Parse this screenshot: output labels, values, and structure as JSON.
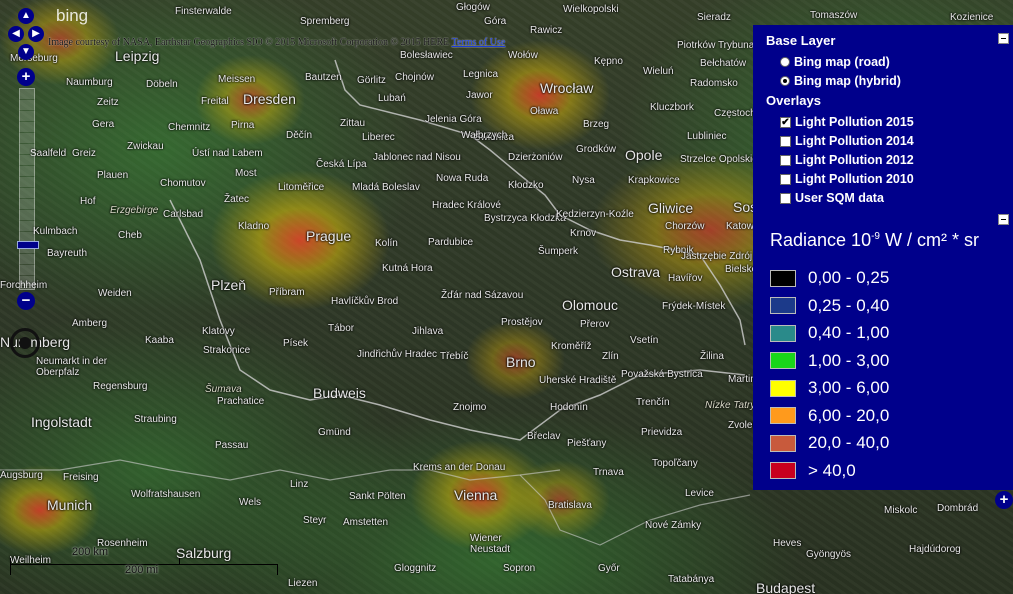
{
  "map": {
    "provider_logo": "bing",
    "credit_text": "Image courtesy of NASA, Earthstar Geographics SIO © 2015 Microsoft Corporation © 2015 HERE",
    "terms_link": "Terms of Use",
    "scale_labels": [
      "200 km",
      "200 mi"
    ],
    "places": [
      {
        "name": "Finsterwalde"
      },
      {
        "name": "Spremberg"
      },
      {
        "name": "Głogów"
      },
      {
        "name": "Góra"
      },
      {
        "name": "Rawicz"
      },
      {
        "name": "Wielkopolski"
      },
      {
        "name": "Sieradz"
      },
      {
        "name": "Tomaszów"
      },
      {
        "name": "Kozienice"
      },
      {
        "name": "Merseburg"
      },
      {
        "name": "Leipzig"
      },
      {
        "name": "Bolesławiec"
      },
      {
        "name": "Wołów"
      },
      {
        "name": "Kępno"
      },
      {
        "name": "Piotrków Trybunalski"
      },
      {
        "name": "Bełchatów"
      },
      {
        "name": "Naumburg"
      },
      {
        "name": "Meissen"
      },
      {
        "name": "Bautzen"
      },
      {
        "name": "Görlitz"
      },
      {
        "name": "Chojnów"
      },
      {
        "name": "Legnica"
      },
      {
        "name": "Wrocław"
      },
      {
        "name": "Wieluń"
      },
      {
        "name": "Radomsko"
      },
      {
        "name": "Zeitz"
      },
      {
        "name": "Döbeln"
      },
      {
        "name": "Freital"
      },
      {
        "name": "Dresden"
      },
      {
        "name": "Lubań"
      },
      {
        "name": "Jawor"
      },
      {
        "name": "Oława"
      },
      {
        "name": "Gera"
      },
      {
        "name": "Chemnitz"
      },
      {
        "name": "Pirna"
      },
      {
        "name": "Zittau"
      },
      {
        "name": "Jelenia Góra"
      },
      {
        "name": "Świdnica"
      },
      {
        "name": "Brzeg"
      },
      {
        "name": "Kluczbork"
      },
      {
        "name": "Częstochowa"
      },
      {
        "name": "Saalfeld"
      },
      {
        "name": "Greiz"
      },
      {
        "name": "Zwickau"
      },
      {
        "name": "Ústí nad Labem"
      },
      {
        "name": "Děčín"
      },
      {
        "name": "Liberec"
      },
      {
        "name": "Wałbrzych"
      },
      {
        "name": "Grodków"
      },
      {
        "name": "Opole"
      },
      {
        "name": "Lubliniec"
      },
      {
        "name": "Plauen"
      },
      {
        "name": "Chomutov"
      },
      {
        "name": "Most"
      },
      {
        "name": "Česká Lípa"
      },
      {
        "name": "Jablonec nad Nisou"
      },
      {
        "name": "Dzierżoniów"
      },
      {
        "name": "Strzelce Opolskie"
      },
      {
        "name": "Hof"
      },
      {
        "name": "Erzgebirge"
      },
      {
        "name": "Žatec"
      },
      {
        "name": "Litoměřice"
      },
      {
        "name": "Mladá Boleslav"
      },
      {
        "name": "Nowa Ruda"
      },
      {
        "name": "Kłodzko"
      },
      {
        "name": "Nysa"
      },
      {
        "name": "Krapkowice"
      },
      {
        "name": "Kulmbach"
      },
      {
        "name": "Cheb"
      },
      {
        "name": "Carlsbad"
      },
      {
        "name": "Kladno"
      },
      {
        "name": "Prague"
      },
      {
        "name": "Kolín"
      },
      {
        "name": "Hradec Králové"
      },
      {
        "name": "Bystrzyca Kłodzka"
      },
      {
        "name": "Kędzierzyn-Koźle"
      },
      {
        "name": "Gliwice"
      },
      {
        "name": "Sosnowiec"
      },
      {
        "name": "Bayreuth"
      },
      {
        "name": "Pardubice"
      },
      {
        "name": "Krnov"
      },
      {
        "name": "Rybnik"
      },
      {
        "name": "Chorzów"
      },
      {
        "name": "Katowice"
      },
      {
        "name": "Forchheim"
      },
      {
        "name": "Weiden"
      },
      {
        "name": "Plzeň"
      },
      {
        "name": "Příbram"
      },
      {
        "name": "Kutná Hora"
      },
      {
        "name": "Šumperk"
      },
      {
        "name": "Ostrava"
      },
      {
        "name": "Jastrzębie Zdrój"
      },
      {
        "name": "Bielsko"
      },
      {
        "name": "Havlíčkův Brod"
      },
      {
        "name": "Žďár nad Sázavou"
      },
      {
        "name": "Olomouc"
      },
      {
        "name": "Havířov"
      },
      {
        "name": "Frýdek-Místek"
      },
      {
        "name": "Amberg"
      },
      {
        "name": "Klatovy"
      },
      {
        "name": "Tábor"
      },
      {
        "name": "Jihlava"
      },
      {
        "name": "Prostějov"
      },
      {
        "name": "Přerov"
      },
      {
        "name": "Vsetín"
      },
      {
        "name": "Nuremberg"
      },
      {
        "name": "Kaaba"
      },
      {
        "name": "Strakonice"
      },
      {
        "name": "Písek"
      },
      {
        "name": "Jindřichův Hradec"
      },
      {
        "name": "Třebíč"
      },
      {
        "name": "Brno"
      },
      {
        "name": "Kroměříž"
      },
      {
        "name": "Zlín"
      },
      {
        "name": "Žilina"
      },
      {
        "name": "Neumarkt in der Oberpfalz"
      },
      {
        "name": "Regensburg"
      },
      {
        "name": "Šumava"
      },
      {
        "name": "Budweis"
      },
      {
        "name": "Uherské Hradiště"
      },
      {
        "name": "Považská Bystrica"
      },
      {
        "name": "Martin"
      },
      {
        "name": "Prachatice"
      },
      {
        "name": "Znojmo"
      },
      {
        "name": "Hodonín"
      },
      {
        "name": "Trenčín"
      },
      {
        "name": "Nízke Tatry"
      },
      {
        "name": "Ingolstadt"
      },
      {
        "name": "Straubing"
      },
      {
        "name": "Gmünd"
      },
      {
        "name": "Břeclav"
      },
      {
        "name": "Piešťany"
      },
      {
        "name": "Prievidza"
      },
      {
        "name": "Zvolen"
      },
      {
        "name": "Passau"
      },
      {
        "name": "Krems an der Donau"
      },
      {
        "name": "Trnava"
      },
      {
        "name": "Topoľčany"
      },
      {
        "name": "Augsburg"
      },
      {
        "name": "Freising"
      },
      {
        "name": "Wolfratshausen"
      },
      {
        "name": "Linz"
      },
      {
        "name": "Sankt Pölten"
      },
      {
        "name": "Vienna"
      },
      {
        "name": "Bratislava"
      },
      {
        "name": "Levice"
      },
      {
        "name": "Miskolc"
      },
      {
        "name": "Munich"
      },
      {
        "name": "Wels"
      },
      {
        "name": "Steyr"
      },
      {
        "name": "Amstetten"
      },
      {
        "name": "Nové Zámky"
      },
      {
        "name": "Dombrád"
      },
      {
        "name": "Rosenheim"
      },
      {
        "name": "Salzburg"
      },
      {
        "name": "Wiener Neustadt"
      },
      {
        "name": "Heves"
      },
      {
        "name": "Hajdúdorog"
      },
      {
        "name": "Weilheim"
      },
      {
        "name": "Gloggnitz"
      },
      {
        "name": "Sopron"
      },
      {
        "name": "Győr"
      },
      {
        "name": "Tatabánya"
      },
      {
        "name": "Gyöngyös"
      },
      {
        "name": "Budapest"
      },
      {
        "name": "Liezen"
      }
    ]
  },
  "panel": {
    "base_layer_title": "Base Layer",
    "base_layers": [
      {
        "label": "Bing map (road)",
        "selected": false
      },
      {
        "label": "Bing map (hybrid)",
        "selected": true
      }
    ],
    "overlays_title": "Overlays",
    "overlays": [
      {
        "label": "Light Pollution 2015",
        "checked": true
      },
      {
        "label": "Light Pollution 2014",
        "checked": false
      },
      {
        "label": "Light Pollution 2012",
        "checked": false
      },
      {
        "label": "Light Pollution 2010",
        "checked": false
      },
      {
        "label": "User SQM data",
        "checked": false
      }
    ],
    "legend_title_prefix": "Radiance 10",
    "legend_title_exp": "-9",
    "legend_title_suffix": " W / cm² * sr",
    "legend": [
      {
        "label": "0,00 - 0,25",
        "color": "#000000"
      },
      {
        "label": "0,25 - 0,40",
        "color": "#1c3a8a"
      },
      {
        "label": "0,40 - 1,00",
        "color": "#2a8a8a"
      },
      {
        "label": "1,00 - 3,00",
        "color": "#19d619"
      },
      {
        "label": "3,00 - 6,00",
        "color": "#ffff00"
      },
      {
        "label": "6,00 - 20,0",
        "color": "#ff9a1c"
      },
      {
        "label": "20,0 - 40,0",
        "color": "#c85a3c"
      },
      {
        "label": "> 40,0",
        "color": "#c8001e"
      }
    ]
  },
  "colors": {
    "panel_bg": "#00008b",
    "control_bg": "#00008b"
  }
}
